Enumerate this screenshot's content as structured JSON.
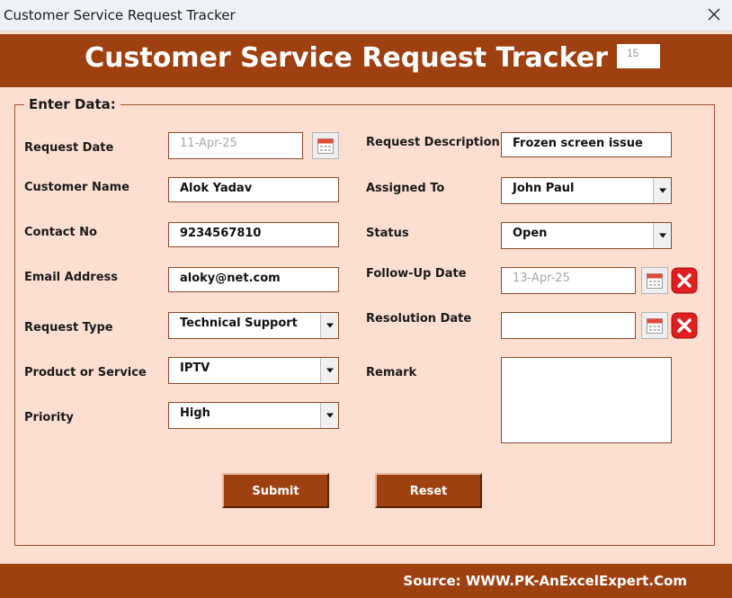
{
  "window": {
    "title": "Customer Service Request Tracker",
    "close_icon": "close-icon"
  },
  "header": {
    "title": "Customer Service Request Tracker",
    "record_counter": "15"
  },
  "form": {
    "section_label": "Enter Data:",
    "request_date": {
      "label": "Request Date",
      "value": "11-Apr-25"
    },
    "customer_name": {
      "label": "Customer Name",
      "value": "Alok Yadav"
    },
    "contact_no": {
      "label": "Contact No",
      "value": "9234567810"
    },
    "email_address": {
      "label": "Email Address",
      "value": "aloky@net.com"
    },
    "request_type": {
      "label": "Request Type",
      "value": "Technical Support"
    },
    "product_or_service": {
      "label": "Product or Service",
      "value": "IPTV"
    },
    "priority": {
      "label": "Priority",
      "value": "High"
    },
    "request_description": {
      "label": "Request Description",
      "value": "Frozen screen issue"
    },
    "assigned_to": {
      "label": "Assigned To",
      "value": "John Paul"
    },
    "status": {
      "label": "Status",
      "value": "Open"
    },
    "follow_up_date": {
      "label": "Follow-Up Date",
      "value": "13-Apr-25"
    },
    "resolution_date": {
      "label": "Resolution Date",
      "value": ""
    },
    "remark": {
      "label": "Remark",
      "value": ""
    }
  },
  "buttons": {
    "submit": "Submit",
    "reset": "Reset"
  },
  "footer": {
    "source": "Source: WWW.PK-AnExcelExpert.Com"
  },
  "colors": {
    "brand": "#9e4010",
    "background": "#fcdfd1",
    "clear_button": "#e02020"
  }
}
